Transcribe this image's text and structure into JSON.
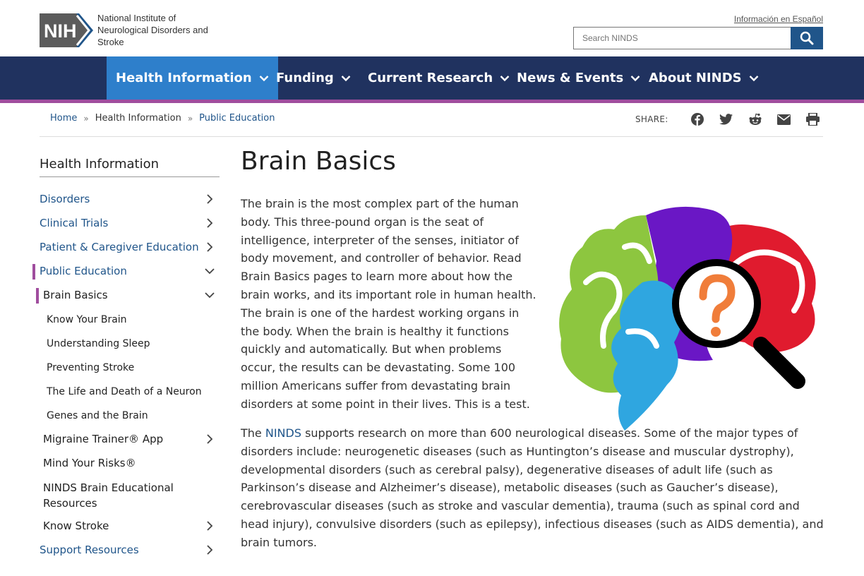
{
  "header": {
    "logo_text": "NIH",
    "institute_name": "National Institute of Neurological Disorders and Stroke",
    "language_link": "Información en Español",
    "search_placeholder": "Search NINDS"
  },
  "nav": {
    "items": [
      {
        "label": "Health Information",
        "active": true
      },
      {
        "label": "Funding"
      },
      {
        "label": "Current Research"
      },
      {
        "label": "News & Events"
      },
      {
        "label": "About NINDS"
      }
    ]
  },
  "breadcrumb": {
    "home": "Home",
    "sep": "»",
    "health": "Health Information",
    "current": "Public Education"
  },
  "share": {
    "label": "SHARE:",
    "icons": [
      "facebook-icon",
      "twitter-icon",
      "reddit-icon",
      "email-icon",
      "print-icon"
    ]
  },
  "sidebar": {
    "title": "Health Information",
    "items": [
      {
        "label": "Disorders"
      },
      {
        "label": "Clinical Trials"
      },
      {
        "label": "Patient & Caregiver Education"
      },
      {
        "label": "Public Education"
      },
      {
        "label": "Brain Basics"
      },
      {
        "label": "Know Your Brain"
      },
      {
        "label": "Understanding Sleep"
      },
      {
        "label": "Preventing Stroke"
      },
      {
        "label": "The Life and Death of a Neuron"
      },
      {
        "label": "Genes and the Brain"
      },
      {
        "label": "Migraine Trainer® App"
      },
      {
        "label": "Mind Your Risks®"
      },
      {
        "label": "NINDS Brain Educational Resources"
      },
      {
        "label": "Know Stroke"
      },
      {
        "label": "Support Resources"
      }
    ]
  },
  "main": {
    "title": "Brain Basics",
    "para1": "The brain is the most complex part of the human body. This three-pound organ is the seat of intelligence, interpreter of the senses, initiator of body movement, and controller of behavior. Read Brain Basics pages to learn more about how the brain works, and its important role in human health. The brain is one of the hardest working organs in the body. When the brain is healthy it functions quickly and automatically. But when problems occur, the results can be devastating. Some 100 million Americans suffer from devastating brain disorders at some point in their lives. This is a test.",
    "para2_prefix": "The ",
    "para2_link": "NINDS",
    "para2_rest": " supports research on more than 600 neurological diseases. Some of the major types of disorders include: neurogenetic diseases (such as Huntington’s disease and muscular dystrophy), developmental disorders (such as cerebral palsy), degenerative diseases of adult life (such as Parkinson’s disease and Alzheimer’s disease), metabolic diseases (such as Gaucher’s disease), cerebrovascular diseases (such as stroke and vascular dementia), trauma (such as spinal cord and head injury), convulsive disorders (such as epilepsy), infectious diseases (such as AIDS dementia), and brain tumors."
  },
  "colors": {
    "nav_bg": "#20325f",
    "nav_active": "#2e7fcb",
    "accent_stripe": "#a04d9e",
    "link": "#20558a"
  }
}
